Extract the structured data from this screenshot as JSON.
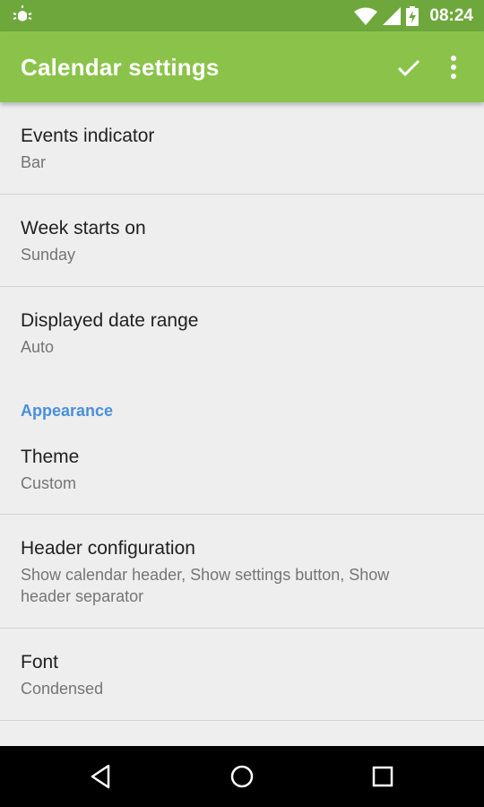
{
  "status_bar": {
    "time": "08:24",
    "icons": [
      "android-debug-icon",
      "wifi-icon",
      "signal-icon",
      "battery-charging-icon"
    ]
  },
  "app_bar": {
    "title": "Calendar settings",
    "actions": [
      "check-icon",
      "more-vert-icon"
    ]
  },
  "preferences": {
    "events_indicator": {
      "title": "Events indicator",
      "summary": "Bar"
    },
    "week_starts_on": {
      "title": "Week starts on",
      "summary": "Sunday"
    },
    "displayed_date_range": {
      "title": "Displayed date range",
      "summary": "Auto"
    },
    "appearance_header": "Appearance",
    "theme": {
      "title": "Theme",
      "summary": "Custom"
    },
    "header_configuration": {
      "title": "Header configuration",
      "summary_line1": "Show calendar header, Show settings button, Show",
      "summary_line2": "header separator"
    },
    "font": {
      "title": "Font",
      "summary": "Condensed"
    }
  },
  "nav_bar": {
    "buttons": [
      "back-icon",
      "home-icon",
      "recents-icon"
    ]
  },
  "colors": {
    "status_bar": "#6ea83d",
    "app_bar": "#8bc34a",
    "background": "#eeeeee",
    "category_accent": "#4a8fdb",
    "nav_bar": "#000000"
  }
}
